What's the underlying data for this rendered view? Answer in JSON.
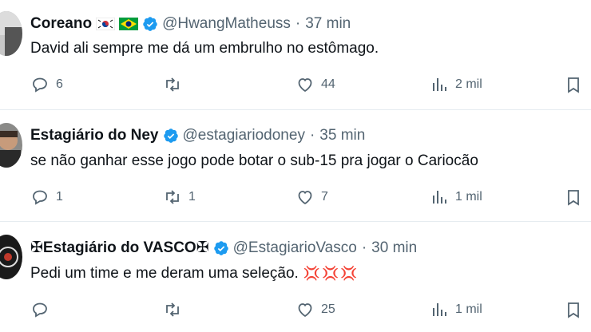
{
  "tweets": [
    {
      "name": "Coreano",
      "handle": "@HwangMatheuss",
      "separator": "·",
      "time": "37 min",
      "text": "David ali sempre me dá um embrulho no estômago.",
      "replies": "6",
      "retweets": "",
      "likes": "44",
      "views": "2 mil"
    },
    {
      "name": "Estagiário do Ney",
      "handle": "@estagiariodoney",
      "separator": "·",
      "time": "35 min",
      "text": "se não ganhar esse jogo pode botar o sub-15 pra jogar o Cariocão",
      "replies": "1",
      "retweets": "1",
      "likes": "7",
      "views": "1 mil"
    },
    {
      "name": "✠Estagiário do VASCO✠",
      "handle": "@EstagiarioVasco",
      "separator": "·",
      "time": "30 min",
      "text": "Pedi um time e me deram uma seleção.",
      "emoji": "💢💢💢",
      "replies": "",
      "retweets": "",
      "likes": "25",
      "views": "1 mil"
    }
  ],
  "colors": {
    "verified": "#1d9bf0",
    "muted": "#536471",
    "divider": "#e6ecf0"
  },
  "icons": [
    "reply-icon",
    "retweet-icon",
    "like-icon",
    "views-icon",
    "bookmark-icon",
    "verified-badge-icon",
    "korea-flag-icon",
    "brazil-flag-icon"
  ]
}
